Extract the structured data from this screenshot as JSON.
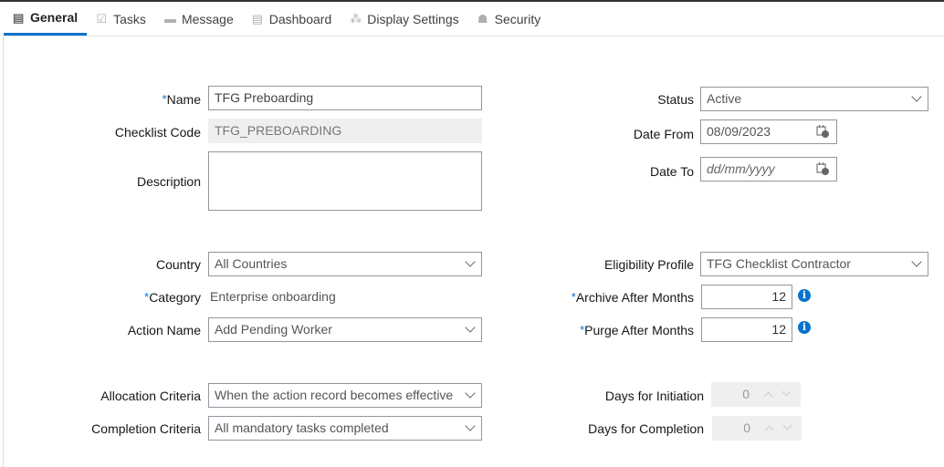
{
  "tabs": [
    {
      "label": "General",
      "icon": "document-list-icon",
      "active": true
    },
    {
      "label": "Tasks",
      "icon": "clipboard-check-icon"
    },
    {
      "label": "Message",
      "icon": "message-icon"
    },
    {
      "label": "Dashboard",
      "icon": "dashboard-icon"
    },
    {
      "label": "Display Settings",
      "icon": "display-settings-icon"
    },
    {
      "label": "Security",
      "icon": "user-security-icon"
    }
  ],
  "form": {
    "name": {
      "label": "Name",
      "value": "TFG Preboarding"
    },
    "checklist_code": {
      "label": "Checklist Code",
      "value": "TFG_PREBOARDING"
    },
    "description": {
      "label": "Description",
      "value": ""
    },
    "country": {
      "label": "Country",
      "value": "All Countries"
    },
    "category": {
      "label": "Category",
      "value": "Enterprise onboarding"
    },
    "action_name": {
      "label": "Action Name",
      "value": "Add Pending Worker"
    },
    "allocation": {
      "label": "Allocation Criteria",
      "value": "When the action record becomes effective"
    },
    "completion": {
      "label": "Completion Criteria",
      "value": "All mandatory tasks completed"
    },
    "status": {
      "label": "Status",
      "value": "Active"
    },
    "date_from": {
      "label": "Date From",
      "value": "08/09/2023"
    },
    "date_to": {
      "label": "Date To",
      "placeholder": "dd/mm/yyyy"
    },
    "eligibility": {
      "label": "Eligibility Profile",
      "value": "TFG Checklist Contractor"
    },
    "archive": {
      "label": "Archive After Months",
      "value": "12"
    },
    "purge": {
      "label": "Purge After Months",
      "value": "12"
    },
    "days_initiation": {
      "label": "Days for Initiation",
      "value": "0"
    },
    "days_completion": {
      "label": "Days for Completion",
      "value": "0"
    },
    "required_mark": "*",
    "info_glyph": "i"
  }
}
